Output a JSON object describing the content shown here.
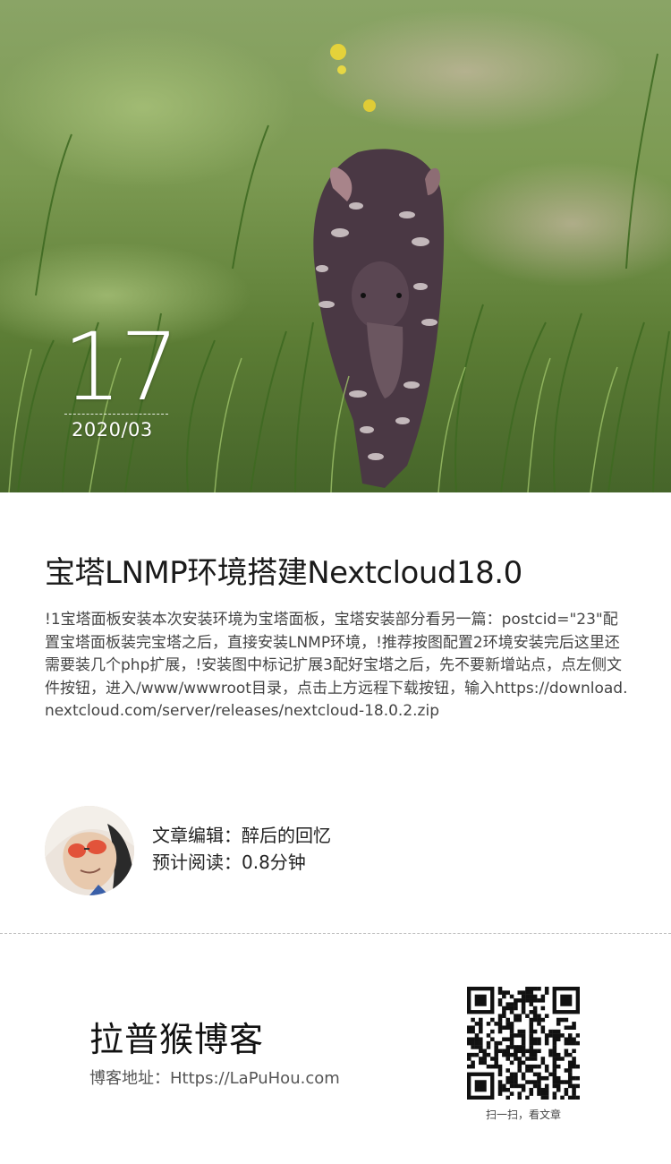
{
  "header": {
    "day": "17",
    "year_month": "2020/03",
    "image_description": "baby-tapir-photo"
  },
  "article": {
    "title": "宝塔LNMP环境搭建Nextcloud18.0",
    "excerpt": "!1宝塔面板安装本次安装环境为宝塔面板，宝塔安装部分看另一篇：postcid=\"23\"配置宝塔面板装完宝塔之后，直接安装LNMP环境，!推荐按图配置2环境安装完后这里还需要装几个php扩展，!安装图中标记扩展3配好宝塔之后，先不要新增站点，点左侧文件按钮，进入/www/wwwroot目录，点击上方远程下载按钮，输入https://download.nextcloud.com/server/releases/nextcloud-18.0.2.zip"
  },
  "author": {
    "editor_label": "文章编辑：醉后的回忆",
    "read_time_label": "预计阅读：0.8分钟"
  },
  "footer": {
    "blog_name": "拉普猴博客",
    "blog_url": "博客地址：Https://LaPuHou.com",
    "qr_caption": "扫一扫，看文章"
  },
  "colors": {
    "title": "#1a1a1a",
    "text": "#444444",
    "divider": "#bdbdbd"
  }
}
